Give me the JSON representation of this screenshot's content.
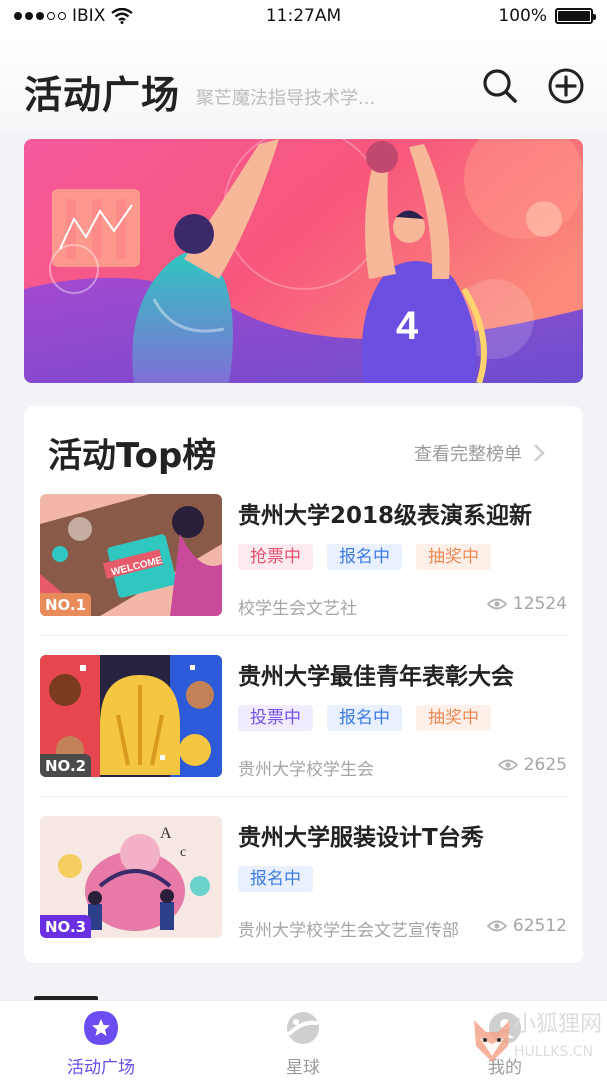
{
  "status_bar": {
    "carrier": "IBIX",
    "time": "11:27AM",
    "battery": "100%",
    "battery_level": 1.0
  },
  "header": {
    "title": "活动广场",
    "search_placeholder": "聚芒魔法指导技术学..."
  },
  "top_list": {
    "title": "活动Top榜",
    "more_label": "查看完整榜单",
    "items": [
      {
        "rank": "NO.1",
        "title": "贵州大学2018级表演系迎新",
        "tags": [
          {
            "label": "抢票中",
            "color": "red"
          },
          {
            "label": "报名中",
            "color": "blue"
          },
          {
            "label": "抽奖中",
            "color": "orange"
          }
        ],
        "org": "校学生会文艺社",
        "views": "12524",
        "thumb_text": "WELCOME"
      },
      {
        "rank": "NO.2",
        "title": "贵州大学最佳青年表彰大会",
        "tags": [
          {
            "label": "投票中",
            "color": "purple"
          },
          {
            "label": "报名中",
            "color": "blue"
          },
          {
            "label": "抽奖中",
            "color": "orange"
          }
        ],
        "org": "贵州大学校学生会",
        "views": "2625"
      },
      {
        "rank": "NO.3",
        "title": "贵州大学服装设计T台秀",
        "tags": [
          {
            "label": "报名中",
            "color": "blue"
          }
        ],
        "org": "贵州大学校学生会文艺宣传部",
        "views": "62512"
      }
    ]
  },
  "tabbar": {
    "tabs": [
      {
        "label": "活动广场",
        "icon": "star-badge-icon",
        "active": true
      },
      {
        "label": "星球",
        "icon": "planet-icon",
        "active": false
      },
      {
        "label": "我的",
        "icon": "profile-icon",
        "active": false
      }
    ]
  },
  "watermark": {
    "text": "小狐狸网",
    "url": "HULLKS.CN"
  },
  "colors": {
    "accent": "#6a4cf0",
    "tag_red": "#e8506f",
    "tag_blue": "#3d7be6",
    "tag_orange": "#ef8a57",
    "tag_purple": "#7753e8"
  }
}
